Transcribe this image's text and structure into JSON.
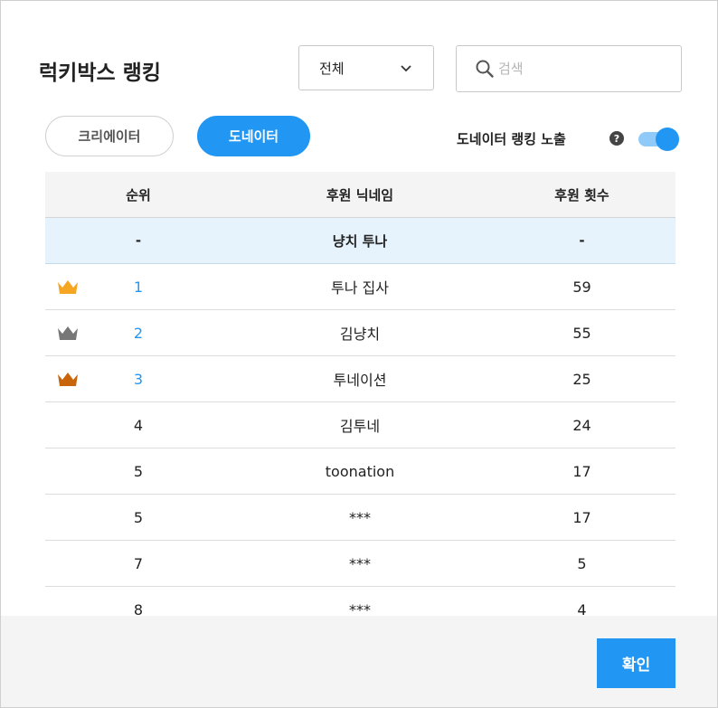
{
  "dialog": {
    "title": "럭키박스 랭킹",
    "filter": {
      "selected": "전체"
    },
    "search": {
      "placeholder": "검색",
      "value": ""
    },
    "tabs": [
      {
        "label": "크리에이터",
        "active": false
      },
      {
        "label": "도네이터",
        "active": true
      }
    ],
    "expose": {
      "label": "도네이터 랭킹 노출",
      "help": "?",
      "enabled": true
    },
    "table": {
      "headers": [
        "순위",
        "후원 닉네임",
        "후원 횟수"
      ],
      "highlight_row": {
        "rank": "-",
        "nickname": "냥치 투나",
        "count": "-"
      },
      "rows": [
        {
          "rank": "1",
          "nickname": "투나 집사",
          "count": "59",
          "crown": "gold"
        },
        {
          "rank": "2",
          "nickname": "김냥치",
          "count": "55",
          "crown": "silver"
        },
        {
          "rank": "3",
          "nickname": "투네이션",
          "count": "25",
          "crown": "bronze"
        },
        {
          "rank": "4",
          "nickname": "김투네",
          "count": "24"
        },
        {
          "rank": "5",
          "nickname": "toonation",
          "count": "17"
        },
        {
          "rank": "5",
          "nickname": "***",
          "count": "17"
        },
        {
          "rank": "7",
          "nickname": "***",
          "count": "5"
        },
        {
          "rank": "8",
          "nickname": "***",
          "count": "4"
        }
      ]
    },
    "confirm_label": "확인",
    "colors": {
      "accent": "#2196f3",
      "gold": "#f5a623",
      "silver": "#777777",
      "bronze": "#c8650a"
    }
  }
}
